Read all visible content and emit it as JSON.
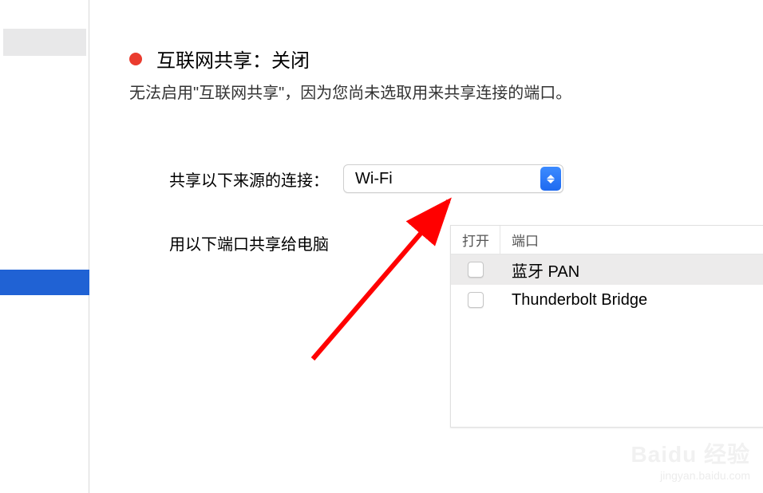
{
  "title": "互联网共享：关闭",
  "subtitle": "无法启用\"互联网共享\"，因为您尚未选取用来共享连接的端口。",
  "status_color": "#ea3b2e",
  "source_label": "共享以下来源的连接：",
  "source_value": "Wi-Fi",
  "ports_label": "用以下端口共享给电脑",
  "list_header_open": "打开",
  "list_header_port": "端口",
  "ports": [
    {
      "name": "蓝牙 PAN",
      "checked": false,
      "selected": true
    },
    {
      "name": "Thunderbolt Bridge",
      "checked": false,
      "selected": false
    }
  ],
  "watermark": {
    "brand": "Baidu 经验",
    "link": "jingyan.baidu.com"
  }
}
